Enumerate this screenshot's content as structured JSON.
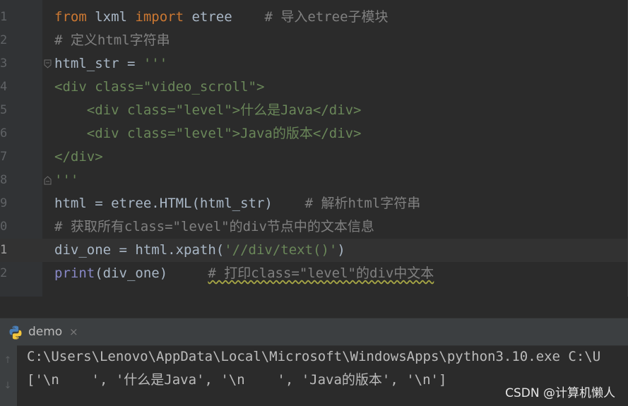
{
  "editor": {
    "lines": [
      {
        "n": "1",
        "tokens": [
          [
            "kw",
            "from"
          ],
          [
            "p",
            " lxml "
          ],
          [
            "kw",
            "import"
          ],
          [
            "p",
            " etree    "
          ],
          [
            "cm",
            "# 导入etree子模块"
          ]
        ]
      },
      {
        "n": "2",
        "tokens": [
          [
            "cm",
            "# 定义html字符串"
          ]
        ]
      },
      {
        "n": "3",
        "fold": true,
        "tokens": [
          [
            "p",
            "html_str = "
          ],
          [
            "str",
            "'''"
          ]
        ]
      },
      {
        "n": "4",
        "tokens": [
          [
            "str",
            "<div class=\"video_scroll\">"
          ]
        ]
      },
      {
        "n": "5",
        "tokens": [
          [
            "str",
            "    <div class=\"level\">什么是Java</div>"
          ]
        ]
      },
      {
        "n": "6",
        "tokens": [
          [
            "str",
            "    <div class=\"level\">Java的版本</div>"
          ]
        ]
      },
      {
        "n": "7",
        "tokens": [
          [
            "str",
            "</div>"
          ]
        ]
      },
      {
        "n": "8",
        "fold": true,
        "tokens": [
          [
            "str",
            "'''"
          ]
        ]
      },
      {
        "n": "9",
        "tokens": [
          [
            "p",
            "html = etree.HTML(html_str)    "
          ],
          [
            "cm",
            "# 解析html字符串"
          ]
        ]
      },
      {
        "n": "0",
        "tokens": [
          [
            "cm",
            "# 获取所有class=\"level\"的div节点中的文本信息"
          ]
        ]
      },
      {
        "n": "1",
        "current": true,
        "tokens": [
          [
            "p",
            "div_one = html.xpath("
          ],
          [
            "str",
            "'//div/text()'"
          ],
          [
            "p",
            ")"
          ]
        ]
      },
      {
        "n": "2",
        "tokens": [
          [
            "bi",
            "print"
          ],
          [
            "p",
            "(div_one)     "
          ],
          [
            "cmw",
            "# 打印class=\"level\"的div中文本"
          ]
        ]
      }
    ]
  },
  "run_panel": {
    "tab_label": "demo",
    "tab_close": "×",
    "tab_icon": "python-icon",
    "output": [
      "C:\\Users\\Lenovo\\AppData\\Local\\Microsoft\\WindowsApps\\python3.10.exe C:\\U",
      "['\\n    ', '什么是Java', '\\n    ', 'Java的版本', '\\n']"
    ],
    "side_buttons": [
      "↑",
      "↓"
    ]
  },
  "watermark": "CSDN @计算机懒人",
  "colors": {
    "background": "#2b2b2b",
    "keyword": "#cc7832",
    "comment": "#808080",
    "string": "#6a8759",
    "builtin": "#8888c6",
    "text": "#a9b7c6"
  }
}
